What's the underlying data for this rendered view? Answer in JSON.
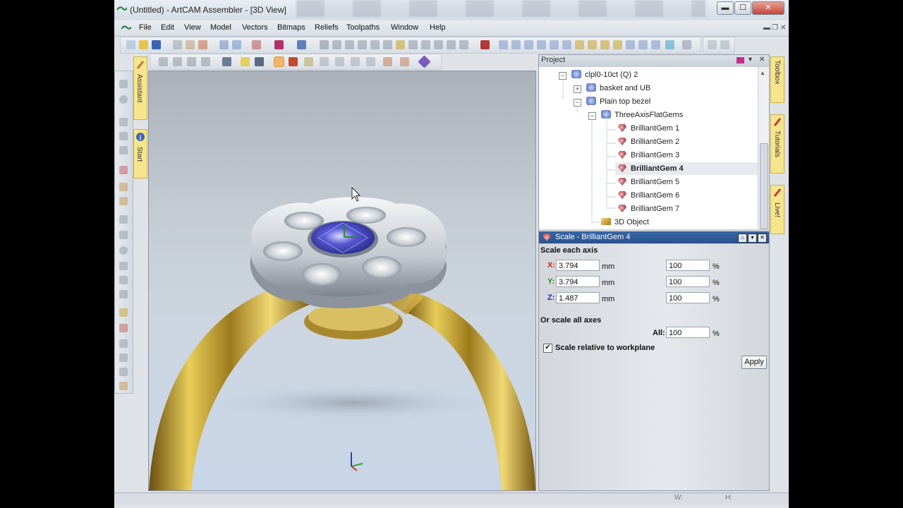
{
  "window": {
    "title": "(Untitled) - ArtCAM Assembler - [3D View]",
    "min_symbol": "▬",
    "max_symbol": "☐",
    "close_symbol": "✕"
  },
  "menubar": {
    "items": [
      "File",
      "Edit",
      "View",
      "Model",
      "Vectors",
      "Bitmaps",
      "Reliefs",
      "Toolpaths",
      "Window",
      "Help"
    ],
    "child_controls": [
      "▬",
      "❐",
      "✕"
    ]
  },
  "left_tabs": {
    "assistant": "Assistant",
    "start": "Start"
  },
  "project": {
    "header": "Project",
    "tree": [
      {
        "label": "clpl0-10ct (Q) 2",
        "icon": "puzzle-icon",
        "expander": "−"
      },
      {
        "label": "basket and UB",
        "icon": "puzzle-icon",
        "expander": "+"
      },
      {
        "label": "Plain top bezel",
        "icon": "puzzle-icon",
        "expander": "−"
      },
      {
        "label": "ThreeAxisFlatGems",
        "icon": "puzzle-icon",
        "expander": "−"
      },
      {
        "label": "BrilliantGem 1",
        "icon": "gem-icon"
      },
      {
        "label": "BrilliantGem 2",
        "icon": "gem-icon"
      },
      {
        "label": "BrilliantGem 3",
        "icon": "gem-icon"
      },
      {
        "label": "BrilliantGem 4",
        "icon": "gem-icon",
        "selected": true
      },
      {
        "label": "BrilliantGem 5",
        "icon": "gem-icon"
      },
      {
        "label": "BrilliantGem 6",
        "icon": "gem-icon"
      },
      {
        "label": "BrilliantGem 7",
        "icon": "gem-icon"
      },
      {
        "label": "3D Object",
        "icon": "3d-object-icon"
      }
    ]
  },
  "scale": {
    "header": "Scale - BrilliantGem 4",
    "each_axis_label": "Scale each axis",
    "x_label": "X:",
    "y_label": "Y:",
    "z_label": "Z:",
    "x_value": "3.794",
    "y_value": "3.794",
    "z_value": "1.487",
    "unit": "mm",
    "x_percent": "100",
    "y_percent": "100",
    "z_percent": "100",
    "pct": "%",
    "all_axes_label": "Or scale all axes",
    "all_label": "All:",
    "all_value": "100",
    "relative_checkbox": "Scale relative to workplane",
    "relative_checked": true,
    "apply": "Apply"
  },
  "right_tabs": {
    "toolbox": "Toolbox",
    "tutorials": "Tutorials",
    "live": "Live!"
  },
  "statusbar": {
    "w_label": "W:",
    "h_label": "H:"
  },
  "colors": {
    "title_bg": "#d4dce6",
    "panel_header_blue": "#2f5b98",
    "gold": "#c9a227",
    "silver": "#c9cfd6",
    "gem_blue": "#4b4cc2"
  }
}
